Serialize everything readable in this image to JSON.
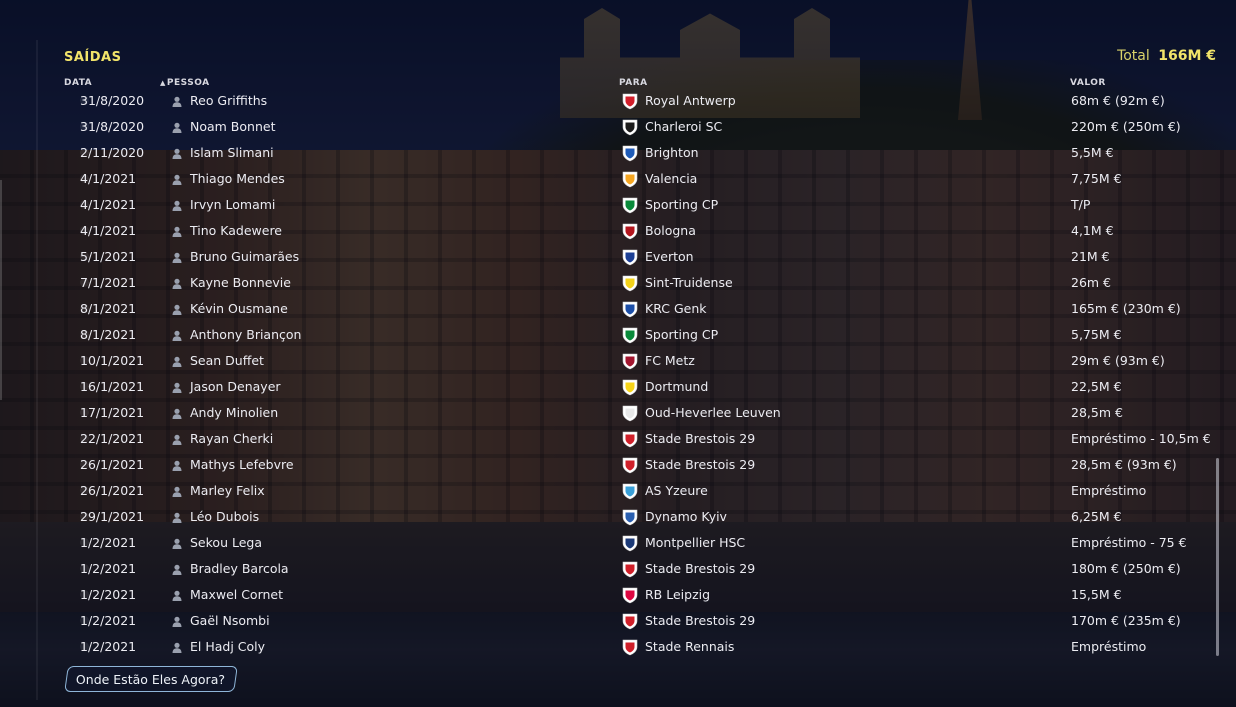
{
  "panel": {
    "title": "SAÍDAS",
    "total_label": "Total",
    "total_value": "166M €"
  },
  "columns": {
    "date": "DATA",
    "person": "PESSOA",
    "to": "PARA",
    "value": "VALOR"
  },
  "rows": [
    {
      "date": "31/8/2020",
      "person": "Reo Griffiths",
      "club": "Royal Antwerp",
      "value": "68m € (92m €)",
      "crest_color": "#d21f2b"
    },
    {
      "date": "31/8/2020",
      "person": "Noam Bonnet",
      "club": "Charleroi SC",
      "value": "220m € (250m €)",
      "crest_color": "#1c1c1c"
    },
    {
      "date": "2/11/2020",
      "person": "Islam Slimani",
      "club": "Brighton",
      "value": "5,5M €",
      "crest_color": "#1f5bb8"
    },
    {
      "date": "4/1/2021",
      "person": "Thiago Mendes",
      "club": "Valencia",
      "value": "7,75M €",
      "crest_color": "#f5a623"
    },
    {
      "date": "4/1/2021",
      "person": "Irvyn Lomami",
      "club": "Sporting CP",
      "value": "T/P",
      "crest_color": "#0a8a3a"
    },
    {
      "date": "4/1/2021",
      "person": "Tino Kadewere",
      "club": "Bologna",
      "value": "4,1M €",
      "crest_color": "#b3161e"
    },
    {
      "date": "5/1/2021",
      "person": "Bruno Guimarães",
      "club": "Everton",
      "value": "21M €",
      "crest_color": "#1c3f95"
    },
    {
      "date": "7/1/2021",
      "person": "Kayne Bonnevie",
      "club": "Sint-Truidense",
      "value": "26m €",
      "crest_color": "#f3d21a"
    },
    {
      "date": "8/1/2021",
      "person": "Kévin Ousmane",
      "club": "KRC Genk",
      "value": "165m € (230m €)",
      "crest_color": "#1d4fa8"
    },
    {
      "date": "8/1/2021",
      "person": "Anthony Briançon",
      "club": "Sporting CP",
      "value": "5,75M €",
      "crest_color": "#0a8a3a"
    },
    {
      "date": "10/1/2021",
      "person": "Sean Duffet",
      "club": "FC Metz",
      "value": "29m € (93m €)",
      "crest_color": "#a3162f"
    },
    {
      "date": "16/1/2021",
      "person": "Jason Denayer",
      "club": "Dortmund",
      "value": "22,5M €",
      "crest_color": "#f7d419"
    },
    {
      "date": "17/1/2021",
      "person": "Andy Minolien",
      "club": "Oud-Heverlee Leuven",
      "value": "28,5m €",
      "crest_color": "#e8e8e8"
    },
    {
      "date": "22/1/2021",
      "person": "Rayan Cherki",
      "club": "Stade Brestois 29",
      "value": "Empréstimo - 10,5m €",
      "crest_color": "#d0202a"
    },
    {
      "date": "26/1/2021",
      "person": "Mathys Lefebvre",
      "club": "Stade Brestois 29",
      "value": "28,5m € (93m €)",
      "crest_color": "#d0202a"
    },
    {
      "date": "26/1/2021",
      "person": "Marley Felix",
      "club": "AS Yzeure",
      "value": "Empréstimo",
      "crest_color": "#3aa0d8"
    },
    {
      "date": "29/1/2021",
      "person": "Léo Dubois",
      "club": "Dynamo Kyiv",
      "value": "6,25M €",
      "crest_color": "#2a5fb0"
    },
    {
      "date": "1/2/2021",
      "person": "Sekou Lega",
      "club": "Montpellier HSC",
      "value": "Empréstimo - 75 €",
      "crest_color": "#1c3a78"
    },
    {
      "date": "1/2/2021",
      "person": "Bradley Barcola",
      "club": "Stade Brestois 29",
      "value": "180m € (250m €)",
      "crest_color": "#d0202a"
    },
    {
      "date": "1/2/2021",
      "person": "Maxwel Cornet",
      "club": "RB Leipzig",
      "value": "15,5M €",
      "crest_color": "#dd0741"
    },
    {
      "date": "1/2/2021",
      "person": "Gaël Nsombi",
      "club": "Stade Brestois 29",
      "value": "170m € (235m €)",
      "crest_color": "#d0202a"
    },
    {
      "date": "1/2/2021",
      "person": "El Hadj Coly",
      "club": "Stade Rennais",
      "value": "Empréstimo",
      "crest_color": "#d0202a"
    }
  ],
  "footer": {
    "button_label": "Onde Estão Eles Agora?"
  }
}
